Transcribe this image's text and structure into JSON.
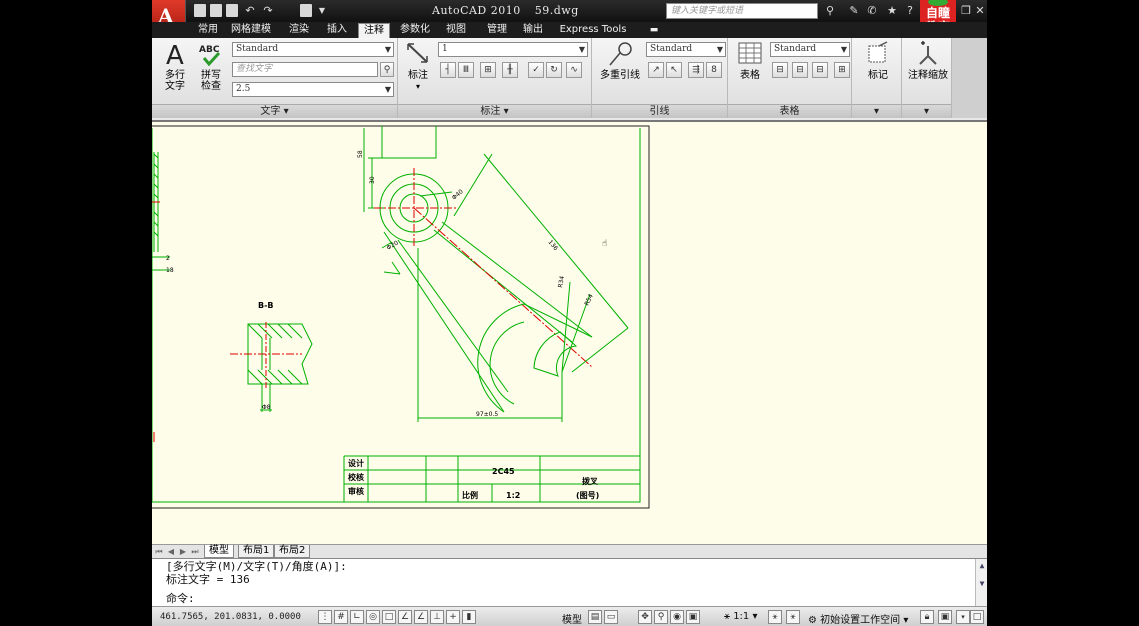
{
  "titlebar": {
    "app_name": "AutoCAD 2010",
    "file_name": "59.dwg",
    "search_placeholder": "键入关键字或短语",
    "brand_line1": "自瞳",
    "brand_line2": "教育"
  },
  "ribbon_tabs": [
    "常用",
    "网格建模",
    "渲染",
    "插入",
    "注释",
    "参数化",
    "视图",
    "管理",
    "输出",
    "Express Tools"
  ],
  "active_tab": "注释",
  "panels": {
    "text": {
      "title": "文字",
      "mtext_label_1": "多行",
      "mtext_label_2": "文字",
      "spell_label_1": "拼写",
      "spell_label_2": "检查",
      "style_value": "Standard",
      "find_placeholder": "查找文字",
      "height_value": "2.5"
    },
    "dimension": {
      "title": "标注",
      "dim_label": "标注",
      "dimstyle_value": "1"
    },
    "leader": {
      "title": "引线",
      "mleader_label": "多重引线",
      "style_value": "Standard"
    },
    "table": {
      "title": "表格",
      "table_label": "表格",
      "style_value": "Standard"
    },
    "markup": {
      "label": "标记"
    },
    "scale": {
      "label": "注释缩放"
    }
  },
  "drawing": {
    "section_label": "B-B",
    "dimensions": {
      "d1": "58",
      "d2": "30",
      "d3": "Φ40",
      "d4": "Φ20",
      "d5": "136",
      "d6": "R34",
      "d7": "R54",
      "d8": "97±0.5",
      "d9": "2",
      "d10": "18",
      "d11": "Φ8"
    },
    "title_block": {
      "design": "设计",
      "check": "校核",
      "review": "审核",
      "material": "2C45",
      "scale_label": "比例",
      "scale_value": "1:2",
      "part_name": "拨叉",
      "drawing_no": "(图号)"
    }
  },
  "layout_tabs": [
    "模型",
    "布局1",
    "布局2"
  ],
  "command": {
    "line1": "[多行文字(M)/文字(T)/角度(A)]:",
    "line2": "标注文字 = 136",
    "prompt": "命令:"
  },
  "statusbar": {
    "coords": "461.7565, 201.0831, 0.0000",
    "model_label": "模型",
    "scale_label": "1:1",
    "workspace_label": "初始设置工作空间"
  },
  "colors": {
    "drawing_bg": "#fdfde9",
    "outline": "#00c000",
    "center_line": "#e00000",
    "dim_text": "#000000"
  }
}
